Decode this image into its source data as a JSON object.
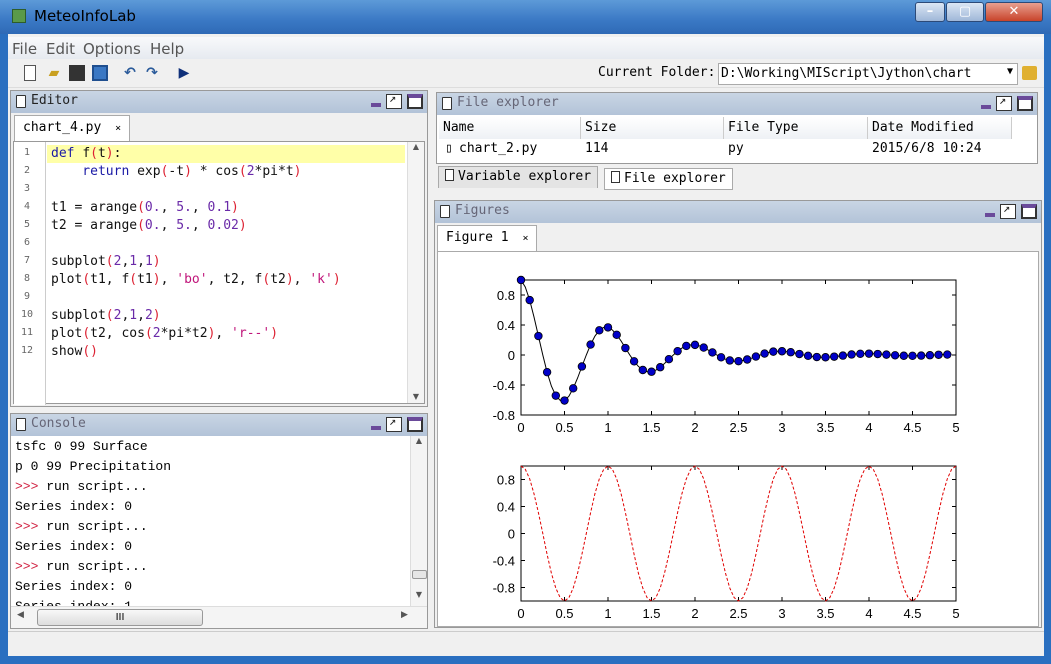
{
  "window": {
    "title": "MeteoInfoLab",
    "controls": [
      "minimize",
      "maximize",
      "close"
    ]
  },
  "menu": [
    "File",
    "Edit",
    "Options",
    "Help"
  ],
  "toolbar": {
    "icons": [
      "new-file-icon",
      "open-folder-icon",
      "save-icon",
      "save-as-icon",
      "undo-icon",
      "redo-icon",
      "run-icon"
    ]
  },
  "current_folder": {
    "label": "Current Folder:",
    "value": "D:\\Working\\MIScript\\Jython\\chart"
  },
  "editor": {
    "title": "Editor",
    "tab": "chart_4.py",
    "tab_close": "×",
    "lines": [
      [
        [
          "def ",
          "kw"
        ],
        [
          "f",
          "tx"
        ],
        [
          "(",
          "pa"
        ],
        [
          "t",
          "tx"
        ],
        [
          ")",
          "pa"
        ],
        [
          ":",
          "tx"
        ]
      ],
      [
        [
          "    return ",
          "kw"
        ],
        [
          "exp",
          "tx"
        ],
        [
          "(",
          "pa"
        ],
        [
          "-t",
          "tx"
        ],
        [
          ")",
          "pa"
        ],
        [
          " * cos",
          "tx"
        ],
        [
          "(",
          "pa"
        ],
        [
          "2",
          "nu"
        ],
        [
          "*pi*t",
          "tx"
        ],
        [
          ")",
          "pa"
        ]
      ],
      [],
      [
        [
          "t1 = arange",
          "tx"
        ],
        [
          "(",
          "pa"
        ],
        [
          "0.",
          "nu"
        ],
        [
          ", ",
          "tx"
        ],
        [
          "5.",
          "nu"
        ],
        [
          ", ",
          "tx"
        ],
        [
          "0.1",
          "nu"
        ],
        [
          ")",
          "pa"
        ]
      ],
      [
        [
          "t2 = arange",
          "tx"
        ],
        [
          "(",
          "pa"
        ],
        [
          "0.",
          "nu"
        ],
        [
          ", ",
          "tx"
        ],
        [
          "5.",
          "nu"
        ],
        [
          ", ",
          "tx"
        ],
        [
          "0.02",
          "nu"
        ],
        [
          ")",
          "pa"
        ]
      ],
      [],
      [
        [
          "subplot",
          "tx"
        ],
        [
          "(",
          "pa"
        ],
        [
          "2",
          "nu"
        ],
        [
          ",",
          "tx"
        ],
        [
          "1",
          "nu"
        ],
        [
          ",",
          "tx"
        ],
        [
          "1",
          "nu"
        ],
        [
          ")",
          "pa"
        ]
      ],
      [
        [
          "plot",
          "tx"
        ],
        [
          "(",
          "pa"
        ],
        [
          "t1, f",
          "tx"
        ],
        [
          "(",
          "pa"
        ],
        [
          "t1",
          "tx"
        ],
        [
          ")",
          "pa"
        ],
        [
          ", ",
          "tx"
        ],
        [
          "'bo'",
          "st"
        ],
        [
          ", t2, f",
          "tx"
        ],
        [
          "(",
          "pa"
        ],
        [
          "t2",
          "tx"
        ],
        [
          ")",
          "pa"
        ],
        [
          ", ",
          "tx"
        ],
        [
          "'k'",
          "st"
        ],
        [
          ")",
          "pa"
        ]
      ],
      [],
      [
        [
          "subplot",
          "tx"
        ],
        [
          "(",
          "pa"
        ],
        [
          "2",
          "nu"
        ],
        [
          ",",
          "tx"
        ],
        [
          "1",
          "nu"
        ],
        [
          ",",
          "tx"
        ],
        [
          "2",
          "nu"
        ],
        [
          ")",
          "pa"
        ]
      ],
      [
        [
          "plot",
          "tx"
        ],
        [
          "(",
          "pa"
        ],
        [
          "t2, cos",
          "tx"
        ],
        [
          "(",
          "pa"
        ],
        [
          "2",
          "nu"
        ],
        [
          "*pi*t2",
          "tx"
        ],
        [
          ")",
          "pa"
        ],
        [
          ", ",
          "tx"
        ],
        [
          "'r--'",
          "st"
        ],
        [
          ")",
          "pa"
        ]
      ],
      [
        [
          "show",
          "tx"
        ],
        [
          "()",
          "pa"
        ]
      ]
    ]
  },
  "console": {
    "title": "Console",
    "lines": [
      {
        "prompt": "",
        "text": "tsfc 0 99 Surface"
      },
      {
        "prompt": "",
        "text": "p 0 99 Precipitation"
      },
      {
        "prompt": ">>>",
        "text": " run script..."
      },
      {
        "prompt": "",
        "text": "Series index: 0"
      },
      {
        "prompt": ">>>",
        "text": " run script..."
      },
      {
        "prompt": "",
        "text": "Series index: 0"
      },
      {
        "prompt": ">>>",
        "text": " run script..."
      },
      {
        "prompt": "",
        "text": "Series index: 0"
      },
      {
        "prompt": "",
        "text": "Series index: 1"
      }
    ],
    "scroll_grip": "III"
  },
  "file_explorer": {
    "title": "File explorer",
    "columns": [
      "Name",
      "Size",
      "File Type",
      "Date Modified"
    ],
    "rows": [
      [
        "chart_2.py",
        "114",
        "py",
        "2015/6/8 10:24"
      ]
    ]
  },
  "explorer_tabs": [
    {
      "label": "Variable explorer",
      "active": false
    },
    {
      "label": "File explorer",
      "active": true
    }
  ],
  "figures": {
    "title": "Figures",
    "tab": "Figure 1",
    "tab_close": "×"
  },
  "colors": {
    "marker": "#0000c8",
    "line_black": "#000000",
    "line_red": "#e00000",
    "title_bar": "#3a78c4",
    "panel_header": "#bccadc"
  },
  "chart_data": [
    {
      "type": "line",
      "subplot": "2,1,1",
      "xlim": [
        0,
        5
      ],
      "ylim": [
        -0.8,
        1.0
      ],
      "xticks": [
        "0",
        "0.5",
        "1",
        "1.5",
        "2",
        "2.5",
        "3",
        "3.5",
        "4",
        "4.5",
        "5"
      ],
      "yticks": [
        "-0.8",
        "-0.4",
        "0",
        "0.4",
        "0.8"
      ],
      "ytick_values": [
        -0.8,
        -0.4,
        0,
        0.4,
        0.8
      ],
      "series": [
        {
          "style": "bo",
          "x": [
            0,
            0.1,
            0.2,
            0.3,
            0.4,
            0.5,
            0.6,
            0.7,
            0.8,
            0.9,
            1,
            1.1,
            1.2,
            1.3,
            1.4,
            1.5,
            1.6,
            1.7,
            1.8,
            1.9,
            2,
            2.1,
            2.2,
            2.3,
            2.4,
            2.5,
            2.6,
            2.7,
            2.8,
            2.9,
            3,
            3.1,
            3.2,
            3.3,
            3.4,
            3.5,
            3.6,
            3.7,
            3.8,
            3.9,
            4,
            4.1,
            4.2,
            4.3,
            4.4,
            4.5,
            4.6,
            4.7,
            4.8,
            4.9
          ],
          "y": [
            1,
            0.732,
            0.253,
            -0.229,
            -0.542,
            -0.607,
            -0.444,
            -0.153,
            0.139,
            0.329,
            0.368,
            0.269,
            0.093,
            -0.084,
            -0.2,
            -0.223,
            -0.163,
            -0.056,
            0.051,
            0.121,
            0.135,
            0.099,
            0.034,
            -0.031,
            -0.073,
            -0.082,
            -0.06,
            -0.021,
            0.019,
            0.045,
            0.05,
            0.037,
            0.013,
            -0.011,
            -0.027,
            -0.03,
            -0.022,
            -0.008,
            0.007,
            0.016,
            0.018,
            0.013,
            0.005,
            -0.004,
            -0.01,
            -0.011,
            -0.008,
            -0.003,
            0.003,
            0.006
          ]
        },
        {
          "style": "k",
          "x": [
            0,
            0.05,
            0.1,
            0.15,
            0.2,
            0.25,
            0.3,
            0.35,
            0.4,
            0.45,
            0.5,
            0.55,
            0.6,
            0.65,
            0.7,
            0.75,
            0.8,
            0.85,
            0.9,
            0.95,
            1,
            1.05,
            1.1,
            1.15,
            1.2,
            1.25,
            1.3,
            1.35,
            1.4,
            1.45,
            1.5,
            1.55,
            1.6,
            1.65,
            1.7,
            1.75,
            1.8,
            1.85,
            1.9,
            1.95,
            2,
            2.05,
            2.1,
            2.15,
            2.2,
            2.25,
            2.3,
            2.35,
            2.4,
            2.45,
            2.5,
            2.55,
            2.6,
            2.65,
            2.7,
            2.75,
            2.8,
            2.85,
            2.9,
            2.95,
            3,
            3.05,
            3.1,
            3.15,
            3.2,
            3.25,
            3.3,
            3.35,
            3.4,
            3.45,
            3.5,
            3.55,
            3.6,
            3.65,
            3.7,
            3.75,
            3.8,
            3.85,
            3.9,
            3.95,
            4,
            4.05,
            4.1,
            4.15,
            4.2,
            4.25,
            4.3,
            4.35,
            4.4,
            4.45,
            4.5,
            4.55,
            4.6,
            4.65,
            4.7,
            4.75,
            4.8,
            4.85,
            4.9,
            4.95
          ],
          "y": [
            1,
            0.905,
            0.732,
            0.506,
            0.253,
            0,
            -0.229,
            -0.414,
            -0.542,
            -0.606,
            -0.607,
            -0.549,
            -0.444,
            -0.307,
            -0.153,
            0,
            0.139,
            0.251,
            0.329,
            0.368,
            0.368,
            0.333,
            0.269,
            0.186,
            0.093,
            0,
            -0.084,
            -0.152,
            -0.2,
            -0.223,
            -0.223,
            -0.202,
            -0.163,
            -0.113,
            -0.056,
            0,
            0.051,
            0.092,
            0.121,
            0.135,
            0.135,
            0.122,
            0.099,
            0.068,
            0.034,
            0,
            -0.031,
            -0.056,
            -0.073,
            -0.082,
            -0.082,
            -0.074,
            -0.06,
            -0.042,
            -0.021,
            0,
            0.019,
            0.034,
            0.045,
            0.05,
            0.05,
            0.045,
            0.037,
            0.025,
            0.013,
            0,
            -0.011,
            -0.021,
            -0.027,
            -0.03,
            -0.03,
            -0.027,
            -0.022,
            -0.015,
            -0.008,
            0,
            0.007,
            0.013,
            0.016,
            0.018,
            0.018,
            0.017,
            0.013,
            0.009,
            0.005,
            0,
            -0.004,
            -0.008,
            -0.01,
            -0.011,
            -0.011,
            -0.01,
            -0.008,
            -0.006,
            -0.003,
            0,
            0.003,
            0.005,
            0.006,
            0.007
          ]
        }
      ]
    },
    {
      "type": "line",
      "subplot": "2,1,2",
      "xlim": [
        0,
        5
      ],
      "ylim": [
        -1,
        1
      ],
      "xticks": [
        "0",
        "0.5",
        "1",
        "1.5",
        "2",
        "2.5",
        "3",
        "3.5",
        "4",
        "4.5",
        "5"
      ],
      "yticks": [
        "-0.8",
        "-0.4",
        "0",
        "0.4",
        "0.8"
      ],
      "ytick_values": [
        -0.8,
        -0.4,
        0,
        0.4,
        0.8
      ],
      "series": [
        {
          "style": "r--",
          "x_period": [
            0,
            0.05,
            0.1,
            0.15,
            0.2,
            0.25,
            0.3,
            0.35,
            0.4,
            0.45,
            0.5,
            0.55,
            0.6,
            0.65,
            0.7,
            0.75,
            0.8,
            0.85,
            0.9,
            0.95
          ],
          "y_period": [
            1,
            0.951,
            0.809,
            0.588,
            0.309,
            0,
            -0.309,
            -0.588,
            -0.809,
            -0.951,
            -1,
            -0.951,
            -0.809,
            -0.588,
            -0.309,
            0,
            0.309,
            0.588,
            0.809,
            0.951
          ],
          "periods": 5
        }
      ]
    }
  ]
}
